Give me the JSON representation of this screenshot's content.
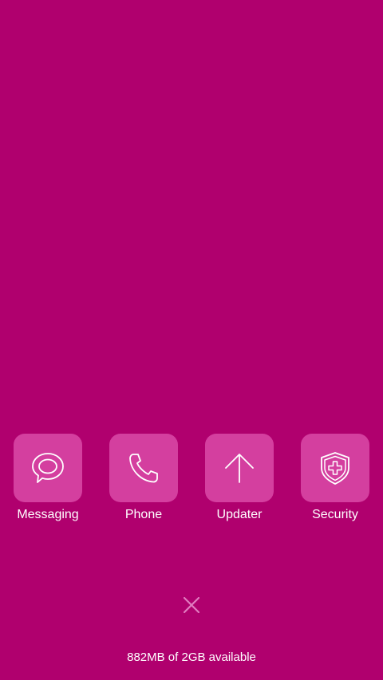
{
  "recent_apps": [
    {
      "label": "Messaging",
      "icon": "chat-bubble-icon"
    },
    {
      "label": "Phone",
      "icon": "phone-icon"
    },
    {
      "label": "Updater",
      "icon": "arrow-up-icon"
    },
    {
      "label": "Security",
      "icon": "shield-plus-icon"
    }
  ],
  "close_all": {
    "icon": "close-icon"
  },
  "memory_status": "882MB of 2GB available",
  "colors": {
    "background": "#B0006E",
    "tile": "#D43F9F",
    "icon_stroke": "#FFFFFF",
    "close_icon": "#E07ABF"
  }
}
